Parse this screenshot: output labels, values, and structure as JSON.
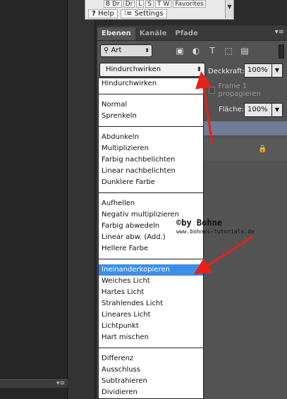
{
  "float_toolbar": {
    "top_buttons": [
      "B Dr",
      "Dr",
      "L",
      "S",
      "T W",
      "Favorites"
    ],
    "help_label": "Help",
    "settings_label": "Settings"
  },
  "panel": {
    "tabs": [
      "Ebenen",
      "Kanäle",
      "Pfade"
    ],
    "filter_label": "Art",
    "blend_mode": "Hindurchwirken",
    "opacity_label": "Deckkraft:",
    "opacity_value": "100%",
    "frame_label": "Frame 1 propagieren",
    "fill_label": "Fläche:",
    "fill_value": "100%"
  },
  "dropdown": {
    "groups": [
      [
        "Hindurchwirken"
      ],
      [
        "Normal",
        "Sprenkeln"
      ],
      [
        "Abdunkeln",
        "Multiplizieren",
        "Farbig nachbelichten",
        "Linear nachbelichten",
        "Dunklere Farbe"
      ],
      [
        "Aufhellen",
        "Negativ multiplizieren",
        "Farbig abwedeln",
        "Linear abw. (Add.)",
        "Hellere Farbe"
      ],
      [
        "Ineinanderkopieren",
        "Weiches Licht",
        "Hartes Licht",
        "Strahlendes Licht",
        "Lineares Licht",
        "Lichtpunkt",
        "Hart mischen"
      ],
      [
        "Differenz",
        "Ausschluss",
        "Subtrahieren",
        "Dividieren"
      ]
    ],
    "highlighted": "Ineinanderkopieren"
  },
  "watermark": {
    "main": "©by Bohne",
    "url": "www.bohnes-tutorials.de"
  },
  "colors": {
    "arrow": "#e8201a",
    "highlight": "#3d8ee6"
  }
}
